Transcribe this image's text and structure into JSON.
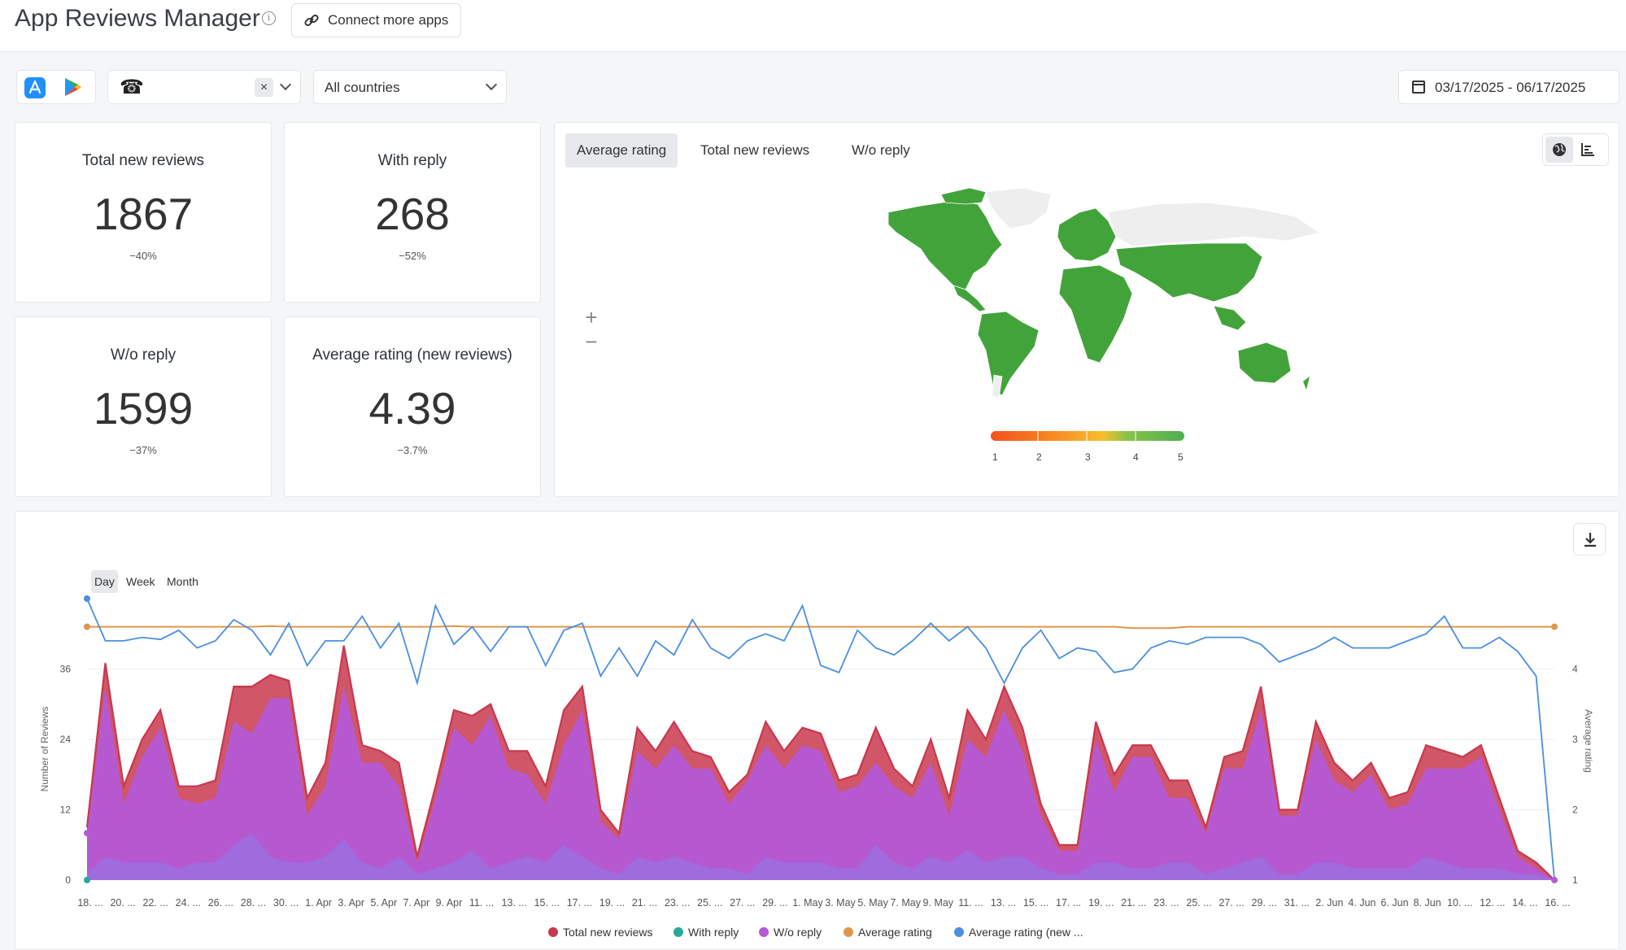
{
  "header": {
    "title": "App Reviews Manager",
    "connect_button_label": "Connect more apps"
  },
  "filters": {
    "stores": [
      "app-store-icon",
      "google-play-icon"
    ],
    "app_icon": "telephone-icon",
    "country": "All countries",
    "date_range": "03/17/2025 - 06/17/2025"
  },
  "stats": [
    {
      "label": "Total new reviews",
      "value": "1867",
      "delta": "−40%"
    },
    {
      "label": "With reply",
      "value": "268",
      "delta": "−52%"
    },
    {
      "label": "W/o reply",
      "value": "1599",
      "delta": "−37%"
    },
    {
      "label": "Average rating (new reviews)",
      "value": "4.39",
      "delta": "−3.7%"
    }
  ],
  "map": {
    "tabs": [
      "Average rating",
      "Total new reviews",
      "W/o reply"
    ],
    "active_tab": 0,
    "scale_labels": [
      "1",
      "2",
      "3",
      "4",
      "5"
    ],
    "scale_colors": [
      "#f4511e",
      "#f57c1f",
      "#f8a42a",
      "#f5c02c",
      "#8bc34a",
      "#4caf50"
    ],
    "zoom_in": "+",
    "zoom_out": "−"
  },
  "chart_controls": {
    "granularity": [
      "Day",
      "Week",
      "Month"
    ],
    "active": 0
  },
  "colors": {
    "total": "#c8384e",
    "with_reply": "#28a89a",
    "wo_reply": "#b45ad7",
    "avg_rating": "#e0964a",
    "avg_rating_new": "#4a8fe0"
  },
  "chart_data": {
    "type": "area",
    "ylabel": "Number of Reviews",
    "ylabel_right": "Average rating",
    "yticks": [
      0,
      12,
      24,
      36
    ],
    "yticks_right": [
      1,
      2,
      3,
      4
    ],
    "ylim": [
      0,
      48
    ],
    "ylim_right": [
      1,
      5
    ],
    "xtick_labels": [
      "18. ...",
      "20. ...",
      "22. ...",
      "24. ...",
      "26. ...",
      "28. ...",
      "30. ...",
      "1. Apr",
      "3. Apr",
      "5. Apr",
      "7. Apr",
      "9. Apr",
      "11. ...",
      "13. ...",
      "15. ...",
      "17. ...",
      "19. ...",
      "21. ...",
      "23. ...",
      "25. ...",
      "27. ...",
      "29. ...",
      "1. May",
      "3. May",
      "5. May",
      "7. May",
      "9. May",
      "11. ...",
      "13. ...",
      "15. ...",
      "17. ...",
      "19. ...",
      "21. ...",
      "23. ...",
      "25. ...",
      "27. ...",
      "29. ...",
      "31. ...",
      "2. Jun",
      "4. Jun",
      "6. Jun",
      "8. Jun",
      "10. ...",
      "12. ...",
      "14. ...",
      "16. ..."
    ],
    "series": [
      {
        "name": "Total new reviews",
        "values": [
          9,
          37,
          16,
          24,
          29,
          16,
          16,
          17,
          33,
          33,
          35,
          34,
          14,
          20,
          40,
          23,
          22,
          20,
          4,
          16,
          29,
          28,
          30,
          22,
          22,
          16,
          29,
          33,
          12,
          8,
          26,
          22,
          27,
          22,
          21,
          15,
          18,
          27,
          22,
          26,
          25,
          17,
          18,
          26,
          19,
          16,
          24,
          14,
          29,
          24,
          33,
          26,
          13,
          6,
          6,
          27,
          18,
          23,
          23,
          17,
          17,
          9,
          21,
          22,
          33,
          12,
          12,
          27,
          20,
          17,
          20,
          14,
          15,
          23,
          22,
          21,
          23,
          14,
          5,
          3,
          0
        ]
      },
      {
        "name": "With reply",
        "values": [
          1,
          4,
          3,
          3,
          3,
          2,
          3,
          3,
          6,
          8,
          4,
          3,
          3,
          4,
          7,
          3,
          2,
          4,
          1,
          2,
          3,
          5,
          2,
          3,
          4,
          3,
          6,
          4,
          2,
          1,
          4,
          3,
          4,
          3,
          2,
          2,
          1,
          4,
          3,
          3,
          3,
          2,
          2,
          6,
          3,
          2,
          4,
          3,
          5,
          3,
          4,
          4,
          2,
          1,
          1,
          3,
          3,
          2,
          2,
          3,
          3,
          1,
          2,
          3,
          4,
          1,
          1,
          3,
          3,
          2,
          2,
          2,
          2,
          4,
          3,
          2,
          2,
          2,
          1,
          1,
          0
        ]
      },
      {
        "name": "W/o reply",
        "values": [
          8,
          33,
          13,
          21,
          26,
          14,
          13,
          14,
          27,
          25,
          31,
          31,
          11,
          16,
          33,
          20,
          20,
          16,
          3,
          14,
          26,
          23,
          28,
          19,
          18,
          13,
          23,
          29,
          10,
          7,
          22,
          19,
          23,
          19,
          19,
          13,
          17,
          23,
          19,
          23,
          22,
          15,
          16,
          20,
          16,
          14,
          20,
          11,
          24,
          21,
          29,
          22,
          11,
          5,
          5,
          24,
          15,
          21,
          21,
          14,
          14,
          8,
          19,
          19,
          29,
          11,
          11,
          24,
          17,
          15,
          18,
          12,
          13,
          19,
          19,
          19,
          21,
          12,
          4,
          2,
          0
        ]
      },
      {
        "name": "Average rating",
        "values": [
          4.6,
          4.6,
          4.6,
          4.6,
          4.6,
          4.6,
          4.6,
          4.6,
          4.6,
          4.6,
          4.61,
          4.6,
          4.6,
          4.6,
          4.6,
          4.6,
          4.6,
          4.6,
          4.6,
          4.6,
          4.61,
          4.6,
          4.6,
          4.6,
          4.6,
          4.6,
          4.6,
          4.6,
          4.6,
          4.6,
          4.6,
          4.6,
          4.6,
          4.6,
          4.6,
          4.6,
          4.6,
          4.6,
          4.6,
          4.6,
          4.6,
          4.6,
          4.6,
          4.6,
          4.6,
          4.6,
          4.6,
          4.6,
          4.6,
          4.6,
          4.6,
          4.6,
          4.6,
          4.6,
          4.6,
          4.6,
          4.6,
          4.58,
          4.58,
          4.58,
          4.6,
          4.6,
          4.6,
          4.6,
          4.6,
          4.6,
          4.6,
          4.6,
          4.6,
          4.6,
          4.6,
          4.6,
          4.6,
          4.6,
          4.6,
          4.6,
          4.6,
          4.6,
          4.6,
          4.6,
          4.6
        ]
      },
      {
        "name": "Average rating (new ...",
        "values": [
          5.0,
          4.4,
          4.4,
          4.45,
          4.42,
          4.55,
          4.3,
          4.4,
          4.7,
          4.55,
          4.2,
          4.65,
          4.05,
          4.4,
          4.4,
          4.75,
          4.3,
          4.65,
          3.8,
          4.9,
          4.35,
          4.6,
          4.25,
          4.6,
          4.6,
          4.05,
          4.55,
          4.65,
          3.9,
          4.3,
          3.9,
          4.4,
          4.2,
          4.7,
          4.3,
          4.15,
          4.4,
          4.5,
          4.4,
          4.9,
          4.05,
          3.95,
          4.55,
          4.3,
          4.2,
          4.4,
          4.65,
          4.4,
          4.6,
          4.3,
          3.8,
          4.3,
          4.55,
          4.15,
          4.3,
          4.25,
          3.95,
          4.0,
          4.3,
          4.4,
          4.35,
          4.45,
          4.45,
          4.45,
          4.35,
          4.1,
          4.2,
          4.3,
          4.45,
          4.3,
          4.3,
          4.3,
          4.4,
          4.5,
          4.75,
          4.3,
          4.3,
          4.45,
          4.25,
          3.9,
          1.0
        ]
      }
    ]
  }
}
